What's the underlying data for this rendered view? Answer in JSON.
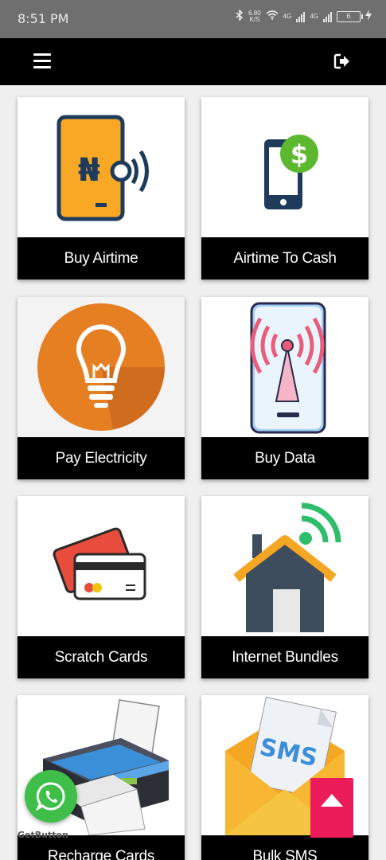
{
  "status_bar": {
    "time": "8:51 PM",
    "speed_value": "6.80",
    "speed_unit": "K/S",
    "network_1": "4G",
    "network_2": "4G",
    "battery": "6"
  },
  "app_bar": {
    "menu_icon": "hamburger-menu-icon",
    "logout_icon": "logout-icon"
  },
  "tiles": [
    {
      "label": "Buy Airtime",
      "icon": "naira-phone-icon"
    },
    {
      "label": "Airtime To Cash",
      "icon": "phone-dollar-icon"
    },
    {
      "label": "Pay Electricity",
      "icon": "lightbulb-icon"
    },
    {
      "label": "Buy Data",
      "icon": "phone-signal-tower-icon"
    },
    {
      "label": "Scratch Cards",
      "icon": "cards-icon"
    },
    {
      "label": "Internet Bundles",
      "icon": "house-wifi-icon"
    },
    {
      "label": "Recharge Cards",
      "icon": "printer-icon"
    },
    {
      "label": "Bulk SMS",
      "icon": "sms-envelope-icon"
    }
  ],
  "floating": {
    "whatsapp_icon": "whatsapp-icon",
    "getbutton_text": "GetButton",
    "scroll_top_icon": "arrow-up-icon"
  },
  "colors": {
    "app_bar": "#000000",
    "status_bar": "#6f6f6f",
    "whatsapp": "#3fbf4a",
    "scroll_top": "#ec1b5a"
  }
}
